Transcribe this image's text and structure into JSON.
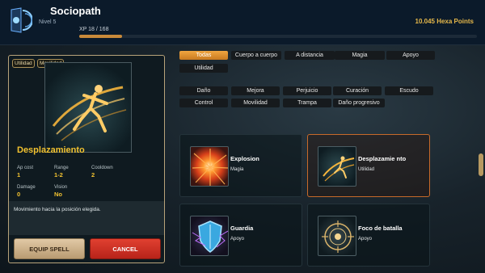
{
  "header": {
    "player_name": "Sociopath",
    "level": "Nivel 5",
    "xp_label": "XP 18 / 168",
    "xp_progress": 0.107,
    "currency": "10.045 Hexa Points"
  },
  "selected_spell": {
    "tags": [
      "Utilidad",
      "Movilidad"
    ],
    "name": "Desplazamiento",
    "stats": [
      {
        "label": "Ap cost",
        "value": "1"
      },
      {
        "label": "Range",
        "value": "1-2"
      },
      {
        "label": "Cooldown",
        "value": "2"
      },
      {
        "label": "Damage",
        "value": "0"
      },
      {
        "label": "Vision",
        "value": "No"
      }
    ],
    "description": "Movimiento hacia la posición elegida.",
    "equip_label": "EQUIP SPELL",
    "cancel_label": "CANCEL"
  },
  "filters": {
    "categories": [
      "Todas",
      "Cuerpo a cuerpo",
      "A distancia",
      "Magia",
      "Apoyo",
      "Utilidad"
    ],
    "active_category": "Todas",
    "effects": [
      "Daño",
      "Mejora",
      "Perjuicio",
      "Curación",
      "Escudo",
      "Control",
      "Movilidad",
      "Trampa",
      "Daño progresivo"
    ]
  },
  "spells": [
    {
      "name": "Explosion",
      "type": "Magia",
      "icon": "explosion-icon"
    },
    {
      "name": "Desplazamie nto",
      "type": "Utilidad",
      "icon": "dash-icon",
      "selected": true
    },
    {
      "name": "Guardia",
      "type": "Apoyo",
      "icon": "guard-shield-icon"
    },
    {
      "name": "Foco de batalla",
      "type": "Apoyo",
      "icon": "battle-focus-icon"
    }
  ],
  "colors": {
    "accent": "#f2c230",
    "active_chip": "#e8962e",
    "cancel": "#d23526",
    "selected_border": "#c76a2a"
  }
}
